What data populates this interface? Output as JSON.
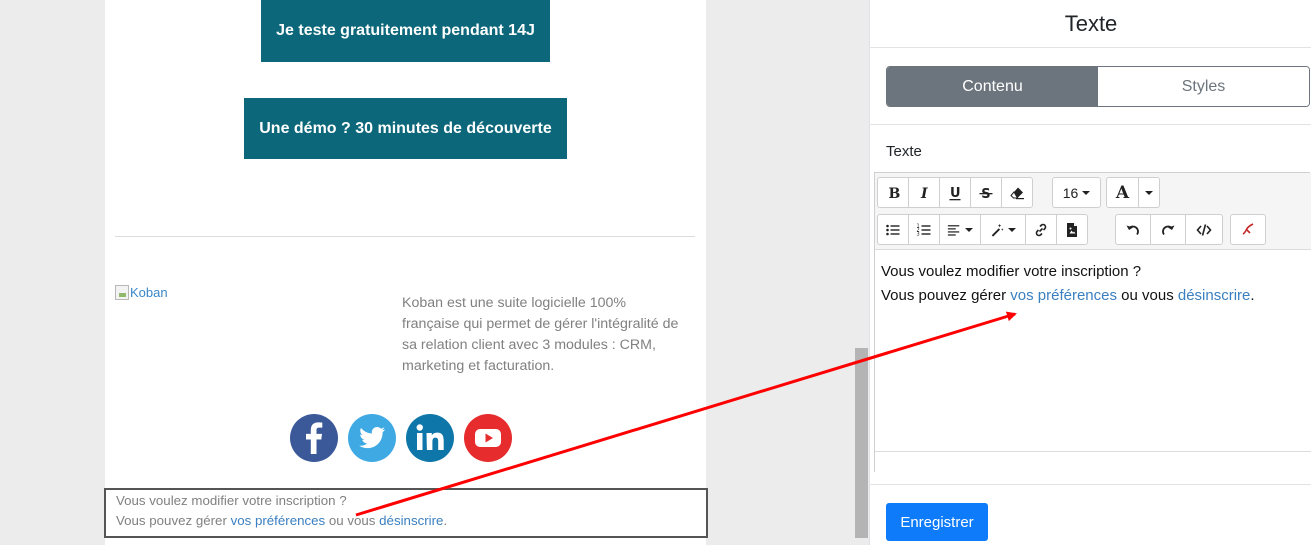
{
  "email": {
    "cta_trial": "Je teste gratuitement pendant 14J",
    "cta_demo": "Une démo ? 30 minutes de découverte",
    "logo_alt": "Koban",
    "description": "Koban est une suite logicielle 100% française qui permet de gérer l'intégralité de sa relation client avec 3 modules : CRM, marketing et facturation.",
    "social": [
      "facebook-icon",
      "twitter-icon",
      "linkedin-icon",
      "youtube-icon"
    ],
    "selected_block": {
      "line1": "Vous voulez modifier votre inscription ?",
      "line2_prefix": "Vous pouvez gérer ",
      "link_prefs": "vos préférences",
      "line2_mid": " ou vous ",
      "link_unsub": "désinscrire",
      "line2_suffix": "."
    }
  },
  "panel": {
    "title": "Texte",
    "tabs": [
      {
        "label": "Contenu",
        "active": true
      },
      {
        "label": "Styles",
        "active": false
      }
    ],
    "field_label": "Texte",
    "toolbar": {
      "font_size": "16",
      "font_color_label": "A"
    },
    "editor": {
      "line1": "Vous voulez modifier votre inscription ?",
      "line2_prefix": "Vous pouvez gérer ",
      "link_prefs": "vos préférences",
      "line2_mid": " ou vous ",
      "link_unsub": "désinscrire",
      "line2_suffix": "."
    },
    "save_label": "Enregistrer"
  },
  "colors": {
    "cta_bg": "#0b6779",
    "tab_active": "#6c757d",
    "save_button": "#0d7bfa",
    "link": "#3a7fc0",
    "arrow": "#ff0000"
  }
}
